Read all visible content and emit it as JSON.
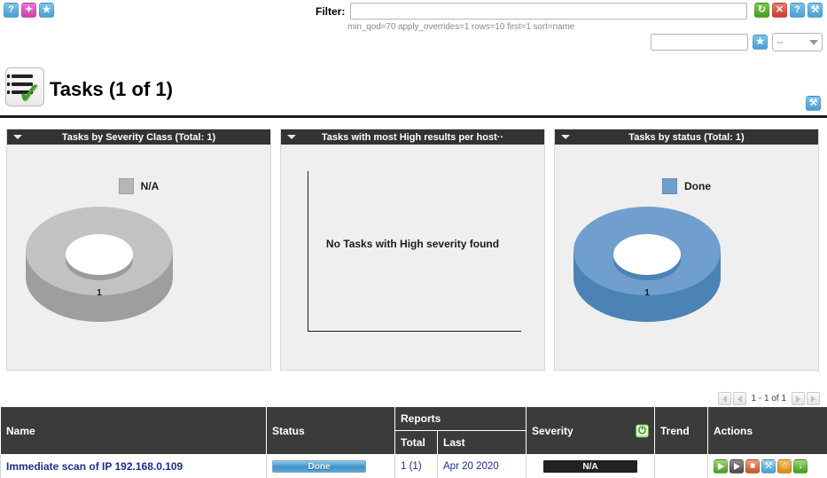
{
  "topbar": {
    "left_icons": [
      {
        "name": "help-icon",
        "glyph": "?"
      },
      {
        "name": "wizard-icon",
        "glyph": "✦"
      },
      {
        "name": "new-filter-icon",
        "glyph": "★"
      }
    ],
    "filter_label": "Filter:",
    "filter_value": "",
    "filter_placeholder": "",
    "filter_description": "min_qod=70 apply_overrides=1 rows=10 first=1 sort=name",
    "right_icons": [
      {
        "name": "refresh-icon",
        "glyph": "↻"
      },
      {
        "name": "reset-filter-icon",
        "glyph": "✕"
      },
      {
        "name": "filter-help-icon",
        "glyph": "?"
      },
      {
        "name": "edit-filter-icon",
        "glyph": "⚒"
      }
    ],
    "name_input_value": "",
    "save_filter_icon": "★",
    "filter_select_value": "--"
  },
  "page": {
    "title": "Tasks (1 of 1)",
    "title_icon": "tasks-list-icon",
    "edit_icon": "⚒"
  },
  "dashboard": {
    "panels": [
      {
        "title": "Tasks by Severity Class (Total: 1)",
        "kind": "donut",
        "legend_label": "N/A",
        "legend_color": "#b6b6b6",
        "value_label": "1"
      },
      {
        "title": "Tasks with most High results per host··",
        "kind": "empty",
        "empty_message": "No Tasks with High severity found"
      },
      {
        "title": "Tasks by status (Total: 1)",
        "kind": "donut",
        "legend_label": "Done",
        "legend_color": "#6f9fcb",
        "value_label": "1"
      }
    ]
  },
  "chart_data": [
    {
      "type": "pie",
      "title": "Tasks by Severity Class (Total: 1)",
      "labels": [
        "N/A"
      ],
      "values": [
        1
      ],
      "colors": [
        "#b6b6b6"
      ],
      "legend_position": "top-center",
      "total": 1
    },
    {
      "type": "bar",
      "title": "Tasks with most High results per host",
      "categories": [],
      "values": [],
      "xlabel": "",
      "ylabel": "",
      "grid": false,
      "annotation": "No Tasks with High severity found"
    },
    {
      "type": "pie",
      "title": "Tasks by status (Total: 1)",
      "labels": [
        "Done"
      ],
      "values": [
        1
      ],
      "colors": [
        "#6f9fcb"
      ],
      "legend_position": "top-center",
      "total": 1
    }
  ],
  "pagination": {
    "first_label": "◀",
    "prev_label": "◀",
    "range_text": "1 - 1 of 1",
    "next_label": "▶",
    "last_label": "▶"
  },
  "table": {
    "headers": {
      "name": "Name",
      "status": "Status",
      "reports": "Reports",
      "reports_total": "Total",
      "reports_last": "Last",
      "severity": "Severity",
      "severity_icon": "⏻",
      "trend": "Trend",
      "actions": "Actions"
    },
    "rows": [
      {
        "name": "Immediate scan of IP 192.168.0.109",
        "status": "Done",
        "reports_total": "1 (1)",
        "reports_last": "Apr 20 2020",
        "severity": "N/A",
        "trend": "",
        "actions": [
          {
            "name": "start-task-action",
            "glyph": ""
          },
          {
            "name": "resume-task-action",
            "glyph": ""
          },
          {
            "name": "delete-task-action",
            "glyph": "🗑"
          },
          {
            "name": "edit-task-action",
            "glyph": "⚒"
          },
          {
            "name": "clone-task-action",
            "glyph": "❐"
          },
          {
            "name": "export-task-action",
            "glyph": "↓"
          }
        ]
      }
    ]
  }
}
